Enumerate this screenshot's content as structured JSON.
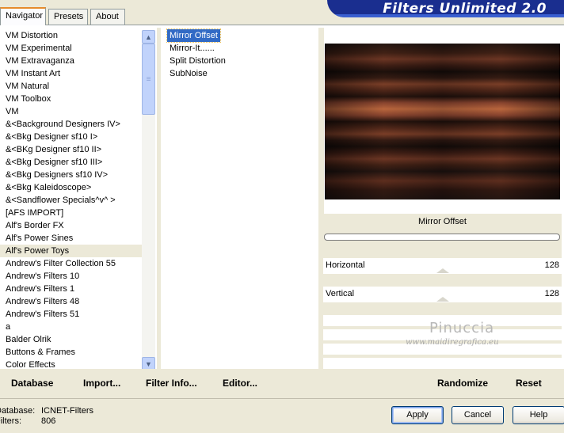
{
  "tabs": [
    "Navigator",
    "Presets",
    "About"
  ],
  "banner_title": "Filters Unlimited 2.0",
  "categories": [
    {
      "label": "VM Distortion"
    },
    {
      "label": "VM Experimental"
    },
    {
      "label": "VM Extravaganza"
    },
    {
      "label": "VM Instant Art"
    },
    {
      "label": "VM Natural"
    },
    {
      "label": "VM Toolbox"
    },
    {
      "label": "VM"
    },
    {
      "label": "&<Background Designers IV>"
    },
    {
      "label": "&<Bkg Designer sf10 I>"
    },
    {
      "label": "&<BKg Designer sf10 II>"
    },
    {
      "label": "&<Bkg Designer sf10 III>"
    },
    {
      "label": "&<Bkg Designers sf10 IV>"
    },
    {
      "label": "&<Bkg Kaleidoscope>"
    },
    {
      "label": "&<Sandflower Specials^v^ >"
    },
    {
      "label": "[AFS IMPORT]"
    },
    {
      "label": "Alf's Border FX"
    },
    {
      "label": "Alf's Power Sines"
    },
    {
      "label": "Alf's Power Toys",
      "selected": true
    },
    {
      "label": "Andrew's Filter Collection 55"
    },
    {
      "label": "Andrew's Filters 10"
    },
    {
      "label": "Andrew's Filters 1"
    },
    {
      "label": "Andrew's Filters 48"
    },
    {
      "label": "Andrew's Filters 51"
    },
    {
      "label": "a"
    },
    {
      "label": "Balder Olrik"
    },
    {
      "label": "Buttons & Frames"
    },
    {
      "label": "Color Effects"
    }
  ],
  "filters": [
    {
      "label": "Mirror Offset",
      "selected": true
    },
    {
      "label": "Mirror-It......"
    },
    {
      "label": "Split Distortion"
    },
    {
      "label": "SubNoise"
    }
  ],
  "params": {
    "title": "Mirror Offset",
    "horizontal_label": "Horizontal",
    "horizontal_value": "128",
    "vertical_label": "Vertical",
    "vertical_value": "128"
  },
  "watermark": {
    "name": "Pinuccia",
    "url": "www.maidiregrafica.eu"
  },
  "bottom_buttons": {
    "database": "Database",
    "import": "Import...",
    "filter_info": "Filter Info...",
    "editor": "Editor...",
    "randomize": "Randomize",
    "reset": "Reset"
  },
  "status": {
    "database_label": "Database:",
    "database_value": "ICNET-Filters",
    "filters_label": "Filters:",
    "filters_value": "806"
  },
  "dialog_buttons": {
    "apply": "Apply",
    "cancel": "Cancel",
    "help": "Help"
  },
  "colors": {
    "selection": "#316ac5",
    "banner": "#1a2e8f",
    "face": "#ece9d8"
  }
}
